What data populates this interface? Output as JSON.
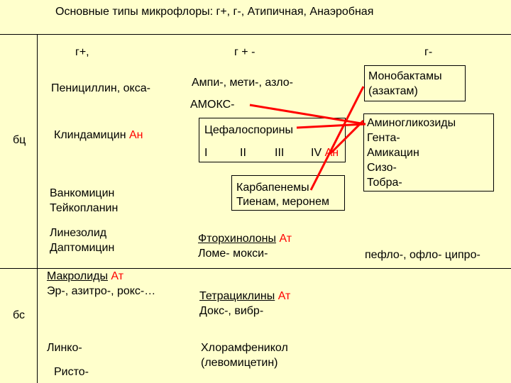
{
  "title": "Основные типы микрофлоры:  г+, г-, Атипичная, Анаэробная",
  "headers": {
    "gpos": "г+,",
    "gposneg": "г + -",
    "gneg": "г-"
  },
  "rows": {
    "bc": "бц",
    "bs": "бс"
  },
  "col1": {
    "penicillin": "Пенициллин, окса-",
    "clinda": "Клиндамицин",
    "clinda_tag": "Ан",
    "vanco1": "Ванкомицин",
    "vanco2": "Тейкопланин",
    "line1": "Линезолид",
    "line2": "Даптомицин",
    "macro": "Макролиды",
    "macro_tag": "Ат",
    "macro2": "Эр-, азитро-, рокс-…",
    "linko": "Линко-",
    "risto": "Ристо-"
  },
  "col2": {
    "ampi": "Ампи-, мети-, азло-",
    "amoks": "АМОКС-",
    "cef": "Цефалоспорины",
    "gen1": "I",
    "gen2": "II",
    "gen3": "III",
    "gen4": "IV",
    "gen4_tag": "Ан",
    "carba1": "Карбапенемы",
    "carba2": "Тиенам, меронем",
    "fq": "Фторхинолоны",
    "fq_tag": "Ат",
    "fq2": "Ломе-  мокси-",
    "tetra": "Тетрациклины",
    "tetra_tag": "Ат",
    "tetra2": "Докс-, вибр-",
    "chlor1": "Хлорамфеникол",
    "chlor2": "(левомицетин)"
  },
  "col3": {
    "mono1": "Монобактамы",
    "mono2": "(азактам)",
    "amino1": "Аминогликозиды",
    "amino2": "Гента-",
    "amino3": "Амикацин",
    "amino4": "Сизо-",
    "amino5": "Тобра-",
    "fq3": "пефло-, офло- ципро-"
  },
  "colors": {
    "background": "#FFFFCC",
    "accent": "#FF0000",
    "text": "#000000"
  }
}
